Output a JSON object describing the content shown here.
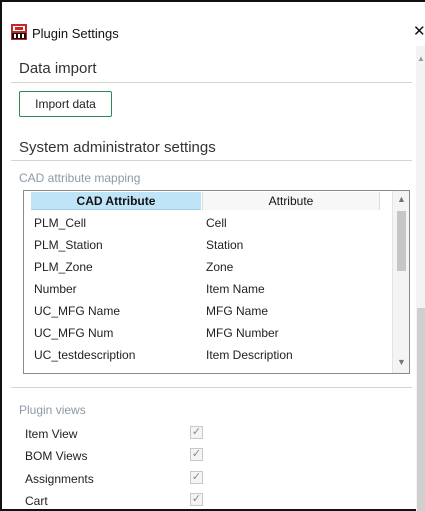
{
  "window": {
    "title": "Plugin Settings",
    "close_glyph": "✕"
  },
  "data_import": {
    "heading": "Data import",
    "button_label": "Import data"
  },
  "admin": {
    "heading": "System administrator settings",
    "cad_mapping_label": "CAD attribute mapping",
    "grid": {
      "columns": [
        "CAD Attribute",
        "Attribute"
      ],
      "rows": [
        {
          "cad": "PLM_Cell",
          "attr": "Cell"
        },
        {
          "cad": "PLM_Station",
          "attr": "Station"
        },
        {
          "cad": "PLM_Zone",
          "attr": "Zone"
        },
        {
          "cad": "Number",
          "attr": "Item Name"
        },
        {
          "cad": "UC_MFG Name",
          "attr": "MFG Name"
        },
        {
          "cad": "UC_MFG Num",
          "attr": "MFG Number"
        },
        {
          "cad": "UC_testdescription",
          "attr": "Item Description"
        }
      ]
    }
  },
  "plugin_views": {
    "label": "Plugin views",
    "items": [
      {
        "label": "Item View",
        "checked": true
      },
      {
        "label": "BOM Views",
        "checked": true
      },
      {
        "label": "Assignments",
        "checked": true
      },
      {
        "label": "Cart",
        "checked": true
      }
    ]
  },
  "icons": {
    "app": "plugin-app-icon",
    "checkmark": "✓",
    "scroll_up": "▲",
    "scroll_down": "▼"
  },
  "colors": {
    "header_selected": "#bfe4f7",
    "button_border": "#2e8b57",
    "group_label": "#8c9aa6"
  }
}
